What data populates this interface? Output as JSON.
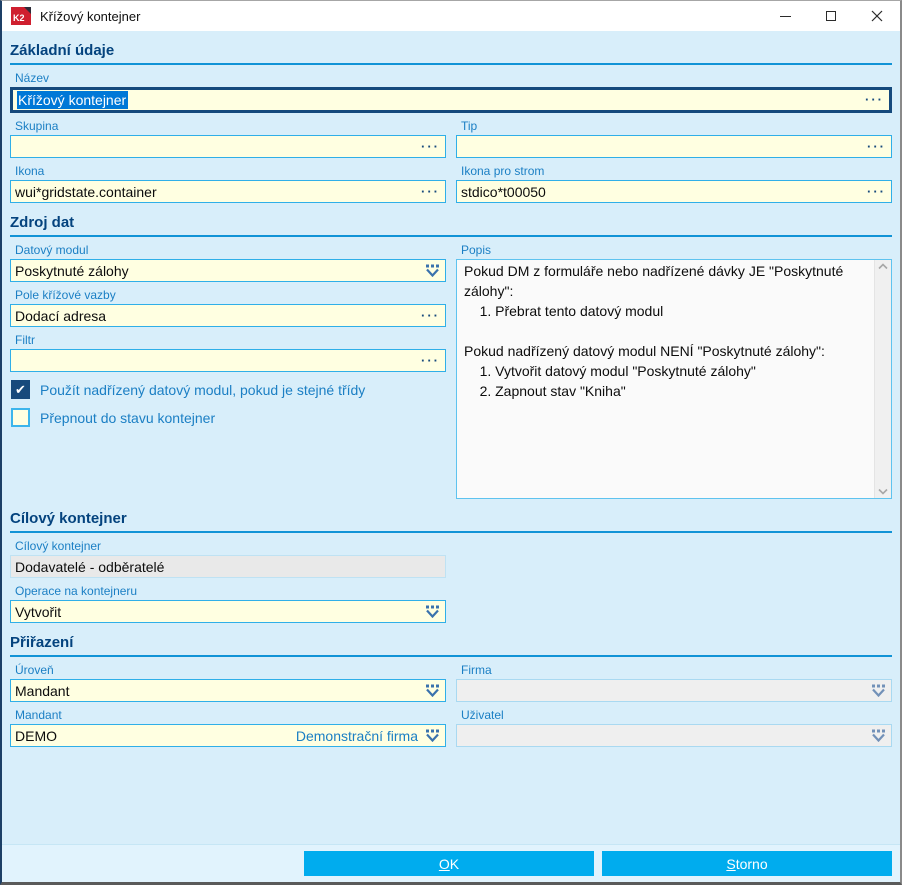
{
  "window": {
    "title": "Křížový kontejner",
    "logo_text": "K2"
  },
  "icons": {
    "check": "✔",
    "ellipsis": "···"
  },
  "sections": {
    "zakladni": {
      "title": "Základní údaje",
      "nazev": {
        "label": "Název",
        "value": "Křížový kontejner"
      },
      "skupina": {
        "label": "Skupina",
        "value": ""
      },
      "tip": {
        "label": "Tip",
        "value": ""
      },
      "ikona": {
        "label": "Ikona",
        "value": "wui*gridstate.container"
      },
      "ikona_pro_strom": {
        "label": "Ikona pro strom",
        "value": "stdico*t00050"
      }
    },
    "zdroj": {
      "title": "Zdroj dat",
      "datovy_modul": {
        "label": "Datový modul",
        "value": "Poskytnuté zálohy"
      },
      "pole_krizove_vazby": {
        "label": "Pole křížové vazby",
        "value": "Dodací adresa"
      },
      "filtr": {
        "label": "Filtr",
        "value": ""
      },
      "checkbox_nadrizeny": {
        "label": "Použít nadřízený datový modul, pokud je stejné třídy",
        "checked": true
      },
      "checkbox_prepnout": {
        "label": "Přepnout do stavu kontejner",
        "checked": false
      },
      "popis": {
        "label": "Popis",
        "text": "Pokud DM z formuláře nebo nadřízené dávky JE \"Poskytnuté zálohy\":\n    1. Přebrat tento datový modul\n\nPokud nadřízený datový modul NENÍ \"Poskytnuté zálohy\":\n    1. Vytvořit datový modul \"Poskytnuté zálohy\"\n    2. Zapnout stav \"Kniha\""
      }
    },
    "cilovy": {
      "title": "Cílový kontejner",
      "cilovy_kontejner": {
        "label": "Cílový kontejner",
        "value": "Dodavatelé - odběratelé"
      },
      "operace": {
        "label": "Operace na kontejneru",
        "value": "Vytvořit"
      }
    },
    "prirazeni": {
      "title": "Přiřazení",
      "uroven": {
        "label": "Úroveň",
        "value": "Mandant"
      },
      "firma": {
        "label": "Firma",
        "value": ""
      },
      "mandant": {
        "label": "Mandant",
        "value": "DEMO",
        "description": "Demonstrační firma"
      },
      "uzivatel": {
        "label": "Uživatel",
        "value": ""
      }
    }
  },
  "buttons": {
    "ok_key": "O",
    "ok_rest": "K",
    "storno_key": "S",
    "storno_rest": "torno"
  },
  "colors": {
    "accent": "#00acee",
    "section_line": "#1193d6",
    "field_bg": "#ffffe1",
    "field_border": "#2fafe8",
    "focus_border": "#15497c",
    "selection": "#0078d7",
    "label": "#1b7fc4"
  }
}
